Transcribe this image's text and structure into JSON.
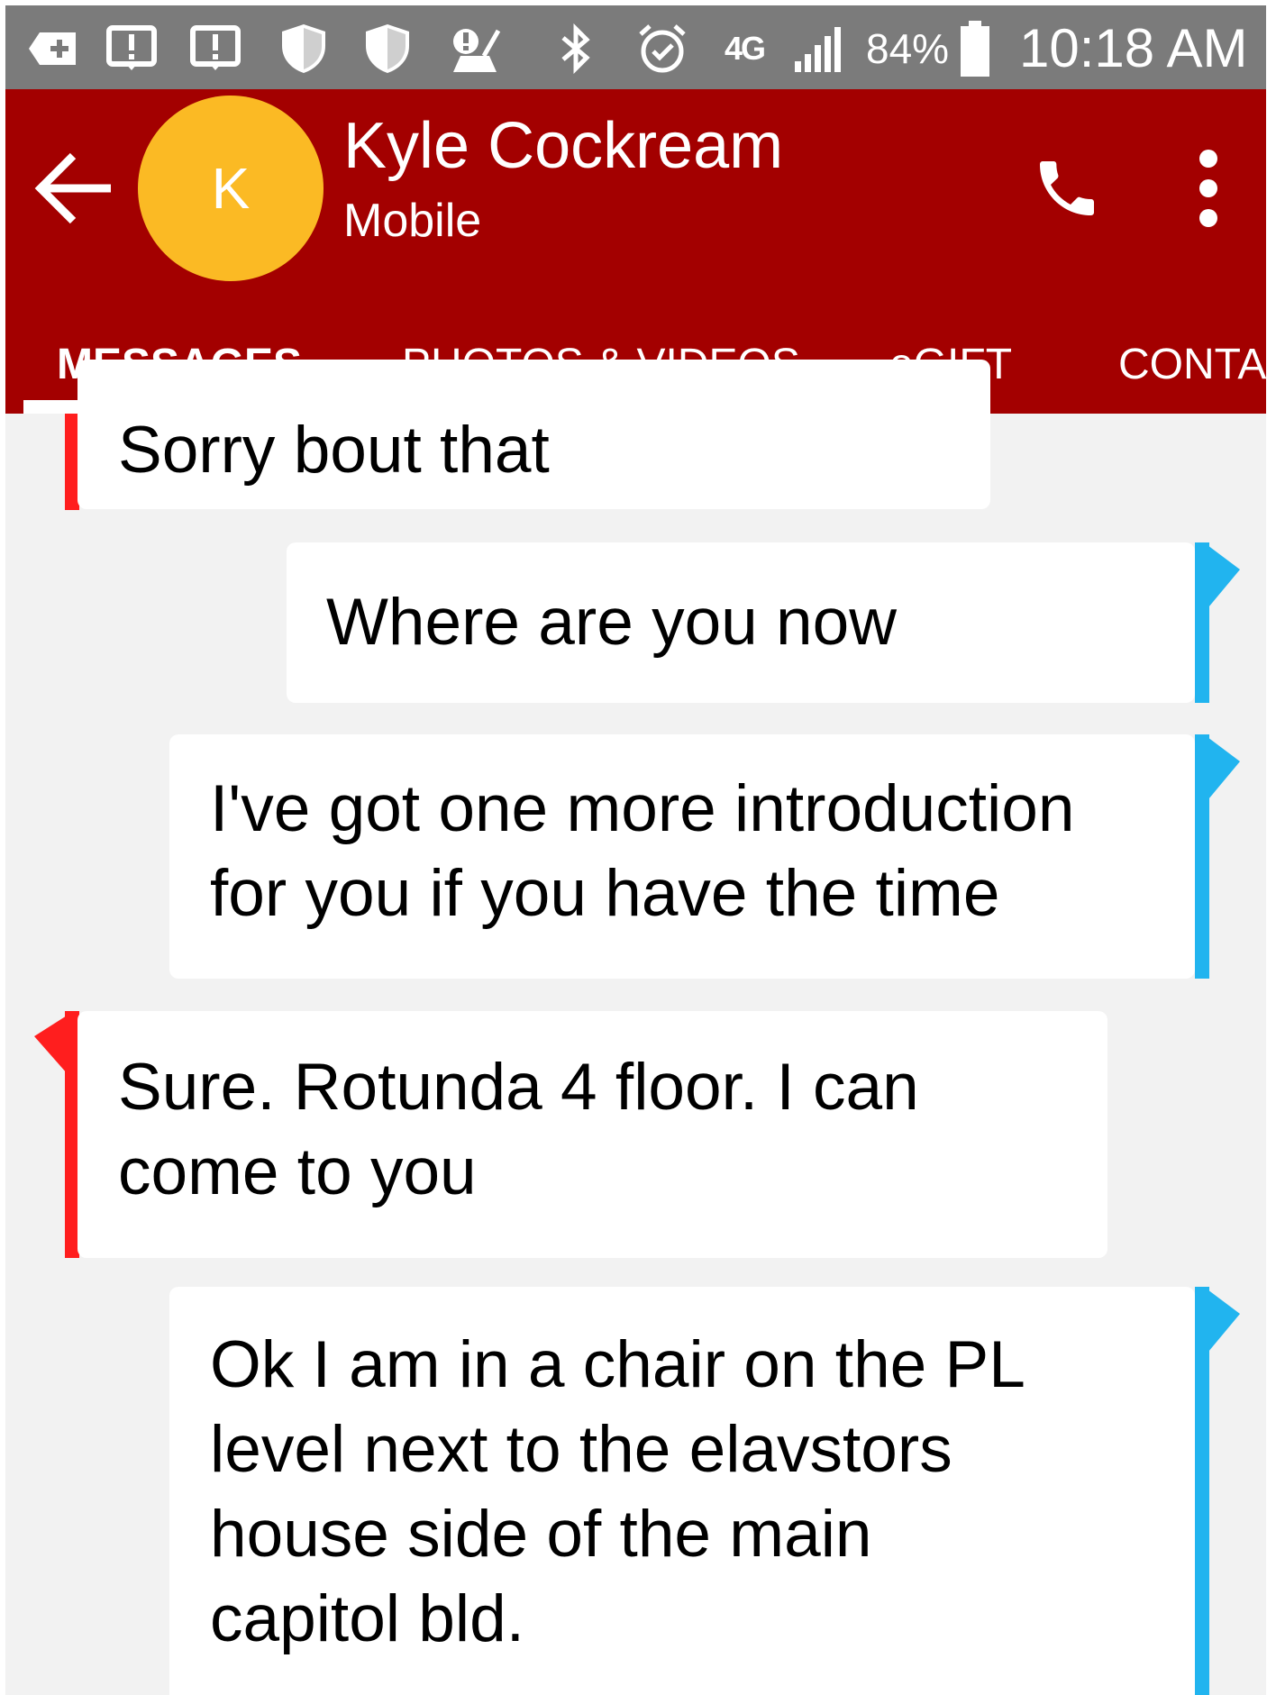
{
  "status_bar": {
    "battery": "84%",
    "time": "10:18 AM",
    "network": "4G",
    "icons": [
      "add-box-icon",
      "alert-icon",
      "alert-icon",
      "shield-icon",
      "shield-icon",
      "cleanup-icon",
      "bluetooth-icon",
      "alarm-icon",
      "lte-icon",
      "signal-icon",
      "battery-icon"
    ]
  },
  "header": {
    "avatar_letter": "K",
    "contact_name": "Kyle Cockream",
    "contact_sub": "Mobile",
    "colors": {
      "bar": "#a30000",
      "avatar": "#fbba24"
    }
  },
  "tabs": [
    {
      "label": "MESSAGES",
      "active": true
    },
    {
      "label": "PHOTOS & VIDEOS",
      "active": false
    },
    {
      "label": "eGIFT",
      "active": false
    },
    {
      "label": "CONTA",
      "active": false
    }
  ],
  "messages": [
    {
      "direction": "incoming",
      "lines": [
        "Sorry bout that"
      ]
    },
    {
      "direction": "outgoing",
      "lines": [
        "Where are you now"
      ]
    },
    {
      "direction": "outgoing",
      "lines": [
        "I've got one more introduction",
        "for you if you have the time"
      ]
    },
    {
      "direction": "incoming",
      "lines": [
        "Sure. Rotunda 4 floor. I can",
        "come to you"
      ]
    },
    {
      "direction": "outgoing",
      "lines": [
        "Ok I am in a chair on the PL",
        "level next to the elavstors",
        "house side of the main",
        "capitol bld."
      ]
    }
  ],
  "colors": {
    "incoming_bar": "#ff1e1e",
    "outgoing_bar": "#21b4ef"
  }
}
